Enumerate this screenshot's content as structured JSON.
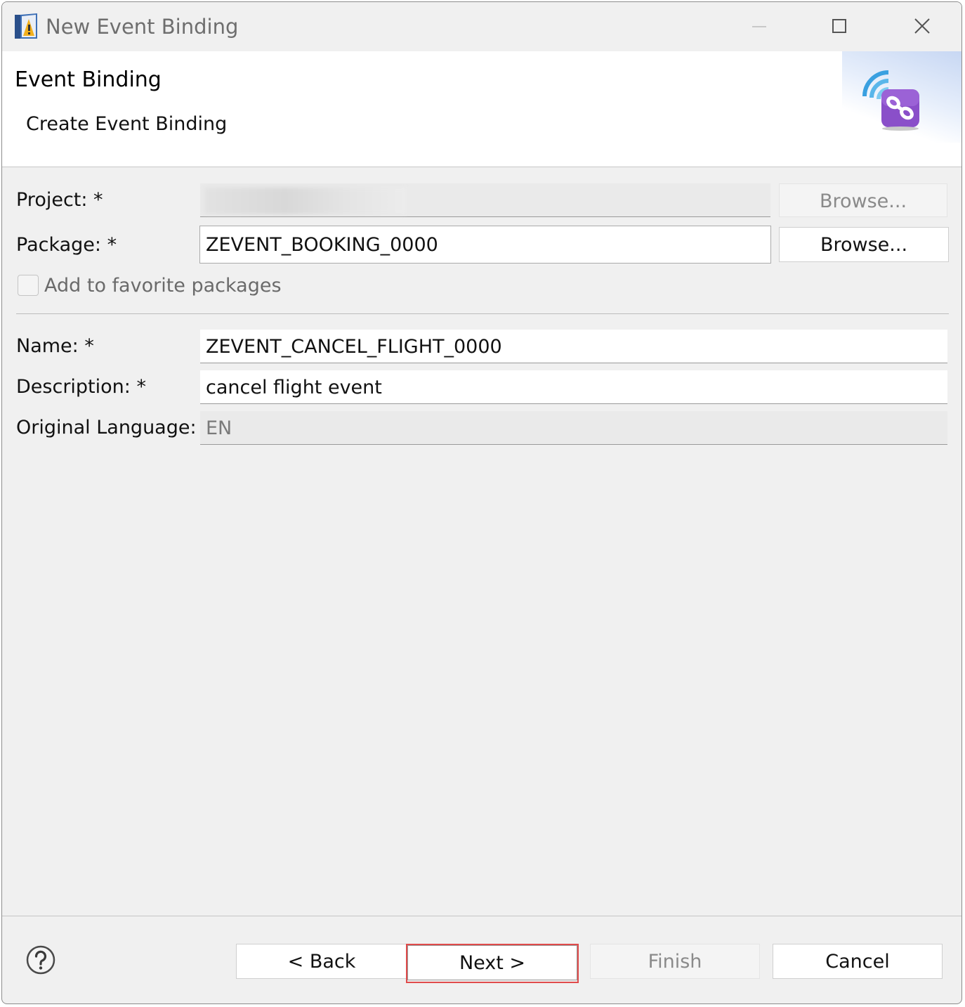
{
  "window": {
    "title": "New Event Binding"
  },
  "banner": {
    "title": "Event Binding",
    "subtitle": "Create Event Binding"
  },
  "form": {
    "project": {
      "label": "Project: *",
      "value": "",
      "browse_label": "Browse..."
    },
    "package": {
      "label": "Package: *",
      "value": "ZEVENT_BOOKING_0000",
      "browse_label": "Browse..."
    },
    "favorite": {
      "label": "Add to favorite packages",
      "checked": false
    },
    "name": {
      "label": "Name: *",
      "value": "ZEVENT_CANCEL_FLIGHT_0000"
    },
    "description": {
      "label": "Description: *",
      "value": "cancel flight event"
    },
    "language": {
      "label": "Original Language:",
      "value": "EN"
    }
  },
  "footer": {
    "back_label": "< Back",
    "next_label": "Next >",
    "finish_label": "Finish",
    "cancel_label": "Cancel"
  },
  "colors": {
    "highlight": "#e04b4b",
    "banner_icon": "#8a4fc9"
  }
}
